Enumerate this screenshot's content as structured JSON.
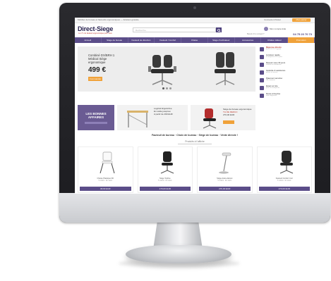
{
  "topbar": {
    "text": "Mobilier de bureau et fauteuils ergonomiques — livraison gratuite",
    "account": "Connexion  Panier",
    "cart_label": "Mon panier"
  },
  "header": {
    "logo_main": "Direct",
    "logo_dash": "-",
    "logo_sub": "Siege",
    "tagline": "Le n°1 du fauteuil ergonomique pour tous",
    "search_placeholder": "Recherche...",
    "account_label": "Mon compte  Aide",
    "phone_label": "Besoin d'un conseil ?",
    "phone": "04 75 20 70 73"
  },
  "nav": {
    "items": [
      "Accueil",
      "Siège de bureau",
      "Fauteuil de direction",
      "Fauteuil / Confort",
      "Chaise",
      "Siège d'ordinateur",
      "Accessoires",
      "Chaise visiteur",
      "Promotion"
    ]
  },
  "hero": {
    "title": "Combiné DX/BRH 1 Médical Siège ergonomique",
    "price": "499 €",
    "button": "Commander"
  },
  "side": {
    "items": [
      {
        "title": "Réponse directe",
        "sub": "04 75 20 70 73 gratuit",
        "alt": true
      },
      {
        "title": "Livraison rapide",
        "sub": "en moyenne 3 à 5 jours",
        "alt": false
      },
      {
        "title": "Retours sous 30 jours",
        "sub": "satisfait ou remboursé",
        "alt": false
      },
      {
        "title": "Garantie & assistance",
        "sub": "pièces et service",
        "alt": false
      },
      {
        "title": "Paiement sécurisé",
        "sub": "CB, virement",
        "alt": false
      },
      {
        "title": "Essai sur site",
        "sub": "pour les entreprises",
        "alt": false
      },
      {
        "title": "Devis entreprise",
        "sub": "tarifs dégressifs",
        "alt": false
      }
    ]
  },
  "promos": {
    "p1_title": "LES BONNES AFFAIRES",
    "p2_title": "Logiciel ErgoActive",
    "p2_sub": "En solde jusqu'au",
    "p2_price": "A partir de 499 EUR",
    "p3_title": "Siège de bureau ergonomique",
    "p3_old": "TH DE REDUC",
    "p3_price": "270,00 EUR"
  },
  "section": {
    "title": "Fauteuil de bureau · Choix de bureau · Siège de bureau · Vente directe !",
    "subtitle": "Produits à l'affiche"
  },
  "products": [
    {
      "name": "Chaise Plastique 3D",
      "meta": "5 coloris · En stock",
      "price": "48,90 EUR"
    },
    {
      "name": "Siège Topfixe",
      "meta": "5 coloris · En stock",
      "price": "179,00 EUR"
    },
    {
      "name": "Siège Assis-debout",
      "meta": "5 coloris · En stock",
      "price": "270,00 EUR"
    },
    {
      "name": "Fauteuil Confort Cuir",
      "meta": "5 coloris · En stock",
      "price": "270,00 EUR"
    }
  ],
  "colors": {
    "brand": "#5b4d89",
    "accent": "#f0a23a",
    "alert": "#c0392b"
  }
}
